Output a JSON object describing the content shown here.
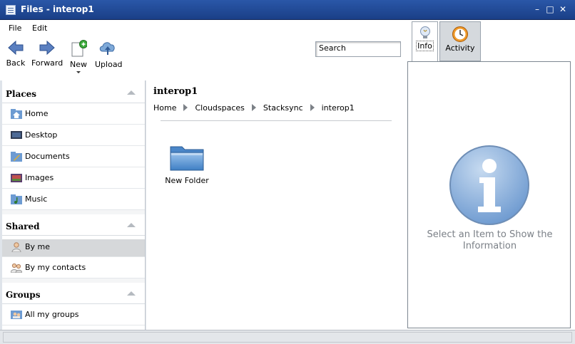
{
  "window": {
    "title": "Files - interop1"
  },
  "menu": {
    "file": "File",
    "edit": "Edit"
  },
  "toolbar": {
    "back": "Back",
    "forward": "Forward",
    "new": "New",
    "upload": "Upload"
  },
  "search": {
    "value": "Search"
  },
  "sidebar": {
    "places": {
      "header": "Places",
      "items": [
        {
          "label": "Home",
          "icon": "home-folder-icon"
        },
        {
          "label": "Desktop",
          "icon": "desktop-icon"
        },
        {
          "label": "Documents",
          "icon": "documents-icon"
        },
        {
          "label": "Images",
          "icon": "images-icon"
        },
        {
          "label": "Music",
          "icon": "music-icon"
        }
      ]
    },
    "shared": {
      "header": "Shared",
      "items": [
        {
          "label": "By me",
          "icon": "user-icon",
          "selected": true
        },
        {
          "label": "By my contacts",
          "icon": "contacts-icon"
        }
      ]
    },
    "groups": {
      "header": "Groups",
      "items": [
        {
          "label": "All my groups",
          "icon": "groups-icon"
        }
      ]
    }
  },
  "main": {
    "folder_title": "interop1",
    "breadcrumb": [
      "Home",
      "Cloudspaces",
      "Stacksync",
      "interop1"
    ],
    "files": [
      {
        "name": "New Folder",
        "icon": "folder-icon"
      }
    ]
  },
  "right_panel": {
    "tabs": {
      "info": "Info",
      "activity": "Activity"
    },
    "active_tab": "Info",
    "message": "Select an Item to Show the Information"
  },
  "colors": {
    "titlebar": "#1f4a98",
    "info_circle": "#7fa7d6",
    "folder": "#5b9ad8"
  }
}
